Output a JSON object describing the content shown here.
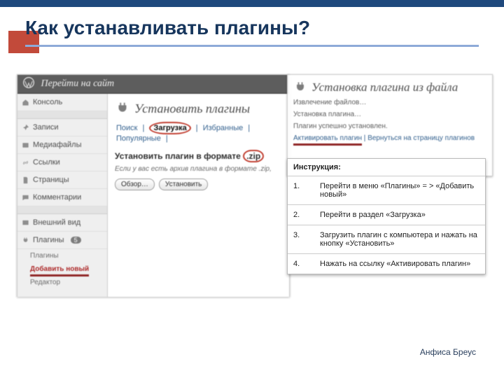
{
  "slide": {
    "title": "Как устанавливать плагины?",
    "author": "Анфиса Бреус"
  },
  "wp": {
    "visit_site": "Перейти на сайт",
    "menu": {
      "console": "Консоль",
      "posts": "Записи",
      "media": "Медиафайлы",
      "links": "Ссылки",
      "pages": "Страницы",
      "comments": "Комментарии",
      "appearance": "Внешний вид",
      "plugins": "Плагины",
      "plugins_count": "5",
      "sub_plugins": "Плагины",
      "sub_add_new": "Добавить новый",
      "sub_editor": "Редактор"
    },
    "main": {
      "heading": "Установить плагины",
      "tabs": {
        "search": "Поиск",
        "upload": "Загрузка",
        "featured": "Избранные",
        "popular": "Популярные",
        "sep": "|"
      },
      "subhead_pre": "Установить плагин в формате",
      "subhead_zip": ".zip",
      "note": "Если у вас есть архив плагина в формате .zip,",
      "browse": "Обзор…",
      "install": "Установить"
    },
    "install_file": {
      "heading": "Установка плагина из файла",
      "l1": "Извлечение файлов…",
      "l2": "Установка плагина…",
      "l3": "Плагин успешно установлен.",
      "link_activate": "Активировать плагин",
      "link_back": "Вернуться на страницу плагинов",
      "sep": " | "
    }
  },
  "instruction": {
    "heading": "Инструкция:",
    "steps": [
      {
        "n": "1.",
        "t": "Перейти в меню «Плагины» = > «Добавить новый»"
      },
      {
        "n": "2.",
        "t": "Перейти в раздел «Загрузка»"
      },
      {
        "n": "3.",
        "t": "Загрузить плагин с компьютера и нажать на кнопку «Установить»"
      },
      {
        "n": "4.",
        "t": "Нажать на ссылку «Активировать плагин»"
      }
    ]
  }
}
